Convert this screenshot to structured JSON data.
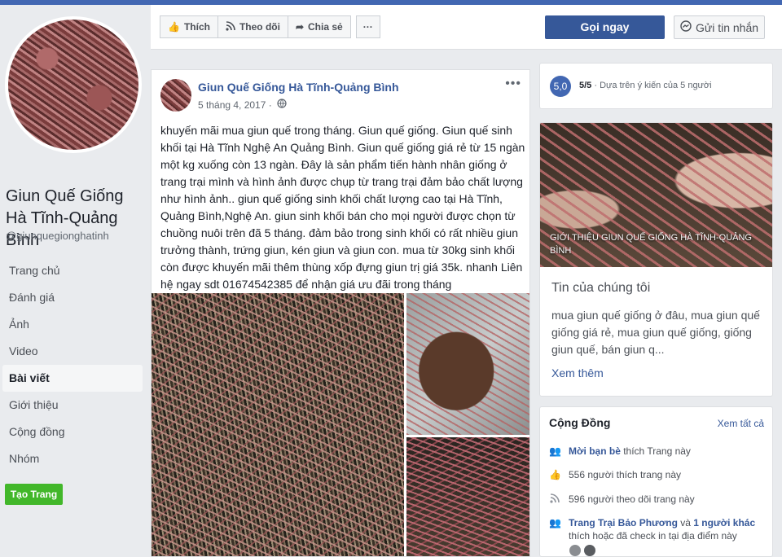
{
  "page": {
    "name": "Giun Quế Giống Hà Tĩnh-Quảng Bình",
    "handle": "@giunquegionghatinh"
  },
  "nav": {
    "items": [
      {
        "label": "Trang chủ"
      },
      {
        "label": "Đánh giá"
      },
      {
        "label": "Ảnh"
      },
      {
        "label": "Video"
      },
      {
        "label": "Bài viết",
        "active": true
      },
      {
        "label": "Giới thiệu"
      },
      {
        "label": "Cộng đồng"
      },
      {
        "label": "Nhóm"
      }
    ],
    "create_page": "Tạo Trang"
  },
  "actions": {
    "like": "Thích",
    "follow": "Theo dõi",
    "share": "Chia sẻ",
    "more": "···",
    "call": "Gọi ngay",
    "message": "Gửi tin nhắn"
  },
  "post": {
    "author": "Giun Quế Giống Hà Tĩnh-Quảng Bình",
    "date": "5 tháng 4, 2017 ·",
    "more": "•••",
    "text": "khuyến mãi mua giun quế trong tháng. Giun quế giống. Giun quế sinh khối tại Hà Tĩnh Nghệ An Quảng Bình. Giun quế giống giá rẻ từ 15 ngàn một kg xuống còn 13 ngàn. Đây là sản phẩm tiến hành nhân giống ở trang trại mình và hình ảnh được chụp từ trang trại đảm bảo chất lượng như hình ảnh.. giun quế giống sinh khối chất lượng cao tại Hà Tĩnh, Quảng Bình,Nghệ An. giun sinh khối bán cho mọi người được chọn từ chuồng nuôi trên đã 5 tháng. đảm bảo trong sinh khối có rất nhiều giun trưởng thành, trứng giun, kén giun và giun con. mua từ 30kg sinh khối còn được khuyến mãi thêm thùng xốp đựng giun trị giá 35k. nhanh Liên hệ ngay sdt 01674542385 để nhận giá ưu đãi trong tháng"
  },
  "rating": {
    "score": "5,0",
    "fraction": "5/5",
    "detail": " · Dựa trên ý kiến của 5 người"
  },
  "about": {
    "caption": "GIỚI THIỆU GIUN QUẾ GIỐNG HÀ TĨNH-QUẢNG BÌNH",
    "title": "Tin của chúng tôi",
    "desc": "mua giun quế giống ở đâu, mua giun quế giống giá rẻ, mua giun quế giống, giống giun quế, bán giun q...",
    "see_more": "Xem thêm"
  },
  "community": {
    "title": "Cộng Đồng",
    "see_all": "Xem tất cả",
    "invite_link": "Mời bạn bè",
    "invite_rest": " thích Trang này",
    "likes": "556 người thích trang này",
    "follows": "596 người theo dõi trang này",
    "checkin_name": "Trang Trại Bảo Phương",
    "checkin_and": " và ",
    "checkin_others": "1 người khác",
    "checkin_rest": "thích hoặc đã check in tại địa điểm này"
  },
  "icons": [
    "like-icon",
    "rss-icon",
    "share-icon",
    "messenger-icon",
    "globe-icon",
    "friends-icon",
    "thumbs-up-icon"
  ],
  "colors": {
    "brand": "#4267b2",
    "link": "#365899",
    "create": "#42b72a",
    "call": "#365899"
  }
}
